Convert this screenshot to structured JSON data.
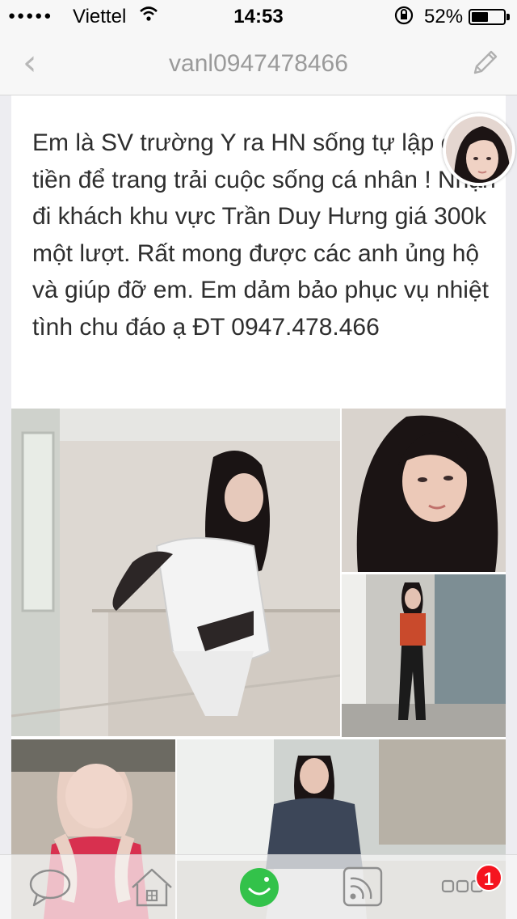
{
  "status_bar": {
    "signal": "●●●●●",
    "carrier": "Viettel",
    "time": "14:53",
    "battery_percent": "52%",
    "battery_level": 0.52,
    "icons": [
      "wifi-icon",
      "orientation-lock-icon",
      "battery-icon"
    ]
  },
  "nav": {
    "back_icon": "chevron-left-icon",
    "title": "vanl0947478466",
    "edit_icon": "pencil-icon"
  },
  "post": {
    "text": "Em là SV trường Y ra HN sống tự lập cần tiền để trang trải cuộc sống cá nhân ! Nhận đi khách khu vực Trần Duy Hưng giá 300k một lượt. Rất mong được các anh ủng hộ và giúp đỡ em. Em dảm bảo phục vụ nhiệt tình chu đáo ạ ĐT 0947.478.466",
    "photo_count": 6
  },
  "tab_bar": {
    "tabs": [
      "chat-bubble-icon",
      "home-icon",
      "smiley-icon",
      "rss-feed-icon",
      "more-dots-icon"
    ],
    "active": "smiley-icon",
    "badge": "1"
  },
  "colors": {
    "accent_green": "#33c24a",
    "badge_red": "#f5141f",
    "title_gray": "#9a9a9a"
  }
}
